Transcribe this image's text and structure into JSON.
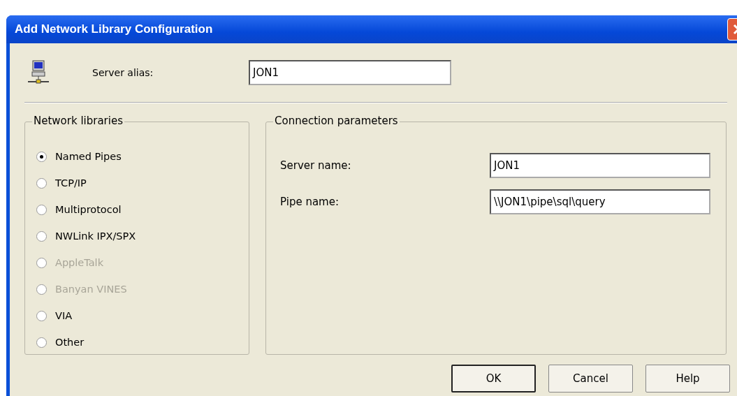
{
  "window": {
    "title": "Add Network Library Configuration"
  },
  "server_alias": {
    "label": "Server alias:",
    "value": "JON1"
  },
  "network_libraries": {
    "title": "Network libraries",
    "options": [
      {
        "label": "Named Pipes",
        "selected": true,
        "disabled": false
      },
      {
        "label": "TCP/IP",
        "selected": false,
        "disabled": false
      },
      {
        "label": "Multiprotocol",
        "selected": false,
        "disabled": false
      },
      {
        "label": "NWLink IPX/SPX",
        "selected": false,
        "disabled": false
      },
      {
        "label": "AppleTalk",
        "selected": false,
        "disabled": true
      },
      {
        "label": "Banyan VINES",
        "selected": false,
        "disabled": true
      },
      {
        "label": "VIA",
        "selected": false,
        "disabled": false
      },
      {
        "label": "Other",
        "selected": false,
        "disabled": false
      }
    ]
  },
  "connection_parameters": {
    "title": "Connection parameters",
    "fields": [
      {
        "label": "Server name:",
        "value": "JON1"
      },
      {
        "label": "Pipe name:",
        "value": "\\\\JON1\\pipe\\sql\\query"
      }
    ]
  },
  "buttons": [
    {
      "label": "OK",
      "default": true
    },
    {
      "label": "Cancel",
      "default": false
    },
    {
      "label": "Help",
      "default": false
    }
  ]
}
